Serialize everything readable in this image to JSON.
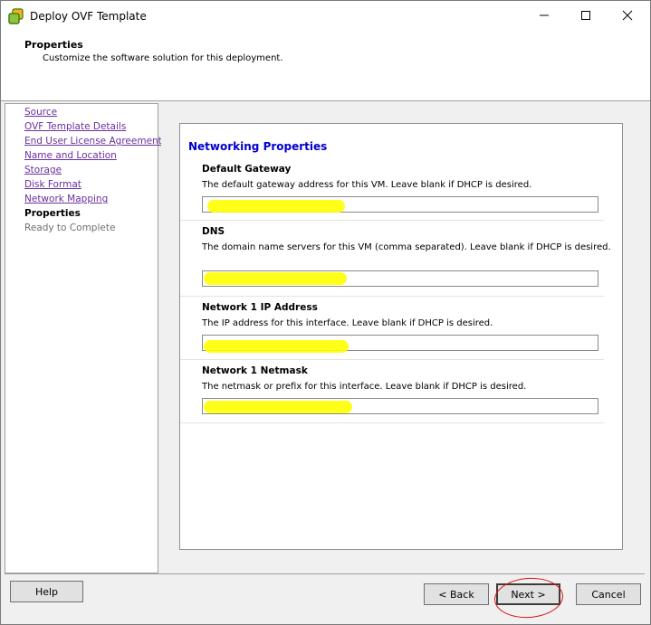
{
  "window": {
    "title": "Deploy OVF Template",
    "icon": "vsphere-icon"
  },
  "header": {
    "title": "Properties",
    "subtitle": "Customize the software solution for this deployment."
  },
  "nav": {
    "items": [
      {
        "label": "Source",
        "state": "link"
      },
      {
        "label": "OVF Template Details",
        "state": "link"
      },
      {
        "label": "End User License Agreement",
        "state": "link"
      },
      {
        "label": "Name and Location",
        "state": "link"
      },
      {
        "label": "Storage",
        "state": "link"
      },
      {
        "label": "Disk Format",
        "state": "link"
      },
      {
        "label": "Network Mapping",
        "state": "link"
      },
      {
        "label": "Properties",
        "state": "current"
      },
      {
        "label": "Ready to Complete",
        "state": "disabled"
      }
    ]
  },
  "section": {
    "title": "Networking Properties"
  },
  "properties": [
    {
      "label": "Default Gateway",
      "description": "The default gateway address for this VM. Leave blank if DHCP is desired.",
      "value": ""
    },
    {
      "label": "DNS",
      "description": "The domain name servers for this VM (comma separated). Leave blank if DHCP is desired.",
      "value": ""
    },
    {
      "label": "Network 1 IP Address",
      "description": "The IP address for this interface. Leave blank if DHCP is desired.",
      "value": ""
    },
    {
      "label": "Network 1 Netmask",
      "description": "The netmask or prefix for this interface. Leave blank if DHCP is desired.",
      "value": ""
    }
  ],
  "buttons": {
    "help": "Help",
    "back": "< Back",
    "next": "Next >",
    "cancel": "Cancel"
  },
  "colors": {
    "highlight": "#ffff00",
    "annotation_circle": "#e01010",
    "section_title": "#0000cc",
    "nav_link": "#6b2fa0"
  }
}
